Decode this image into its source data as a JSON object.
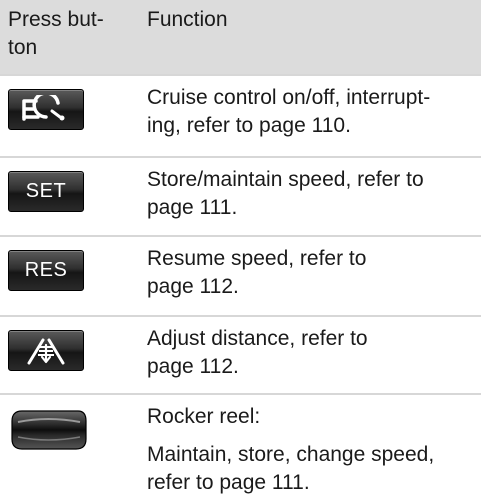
{
  "header": {
    "col1_line1": "Press but-",
    "col1_line2": "ton",
    "col2": "Function"
  },
  "rows": [
    {
      "icon": "cruise-control-icon",
      "button_label": "",
      "text_line1": "Cruise control on/off, interrupt-",
      "text_line2": "ing, refer to page 110."
    },
    {
      "icon": "set-button",
      "button_label": "SET",
      "text_line1": "Store/maintain speed, refer to",
      "text_line2": "page 111."
    },
    {
      "icon": "res-button",
      "button_label": "RES",
      "text_line1": "Resume speed, refer to",
      "text_line2": "page 112."
    },
    {
      "icon": "distance-icon",
      "button_label": "",
      "text_line1": "Adjust distance, refer to",
      "text_line2": "page 112."
    },
    {
      "icon": "rocker-reel-icon",
      "button_label": "",
      "text_line1": "Rocker reel:",
      "text_line2": "Maintain, store, change speed,",
      "text_line3": "refer to page 111."
    }
  ],
  "colors": {
    "header_bg": "#dcdcdc",
    "divider": "#d7d7d7",
    "button_bg": "#2a2a2a"
  }
}
